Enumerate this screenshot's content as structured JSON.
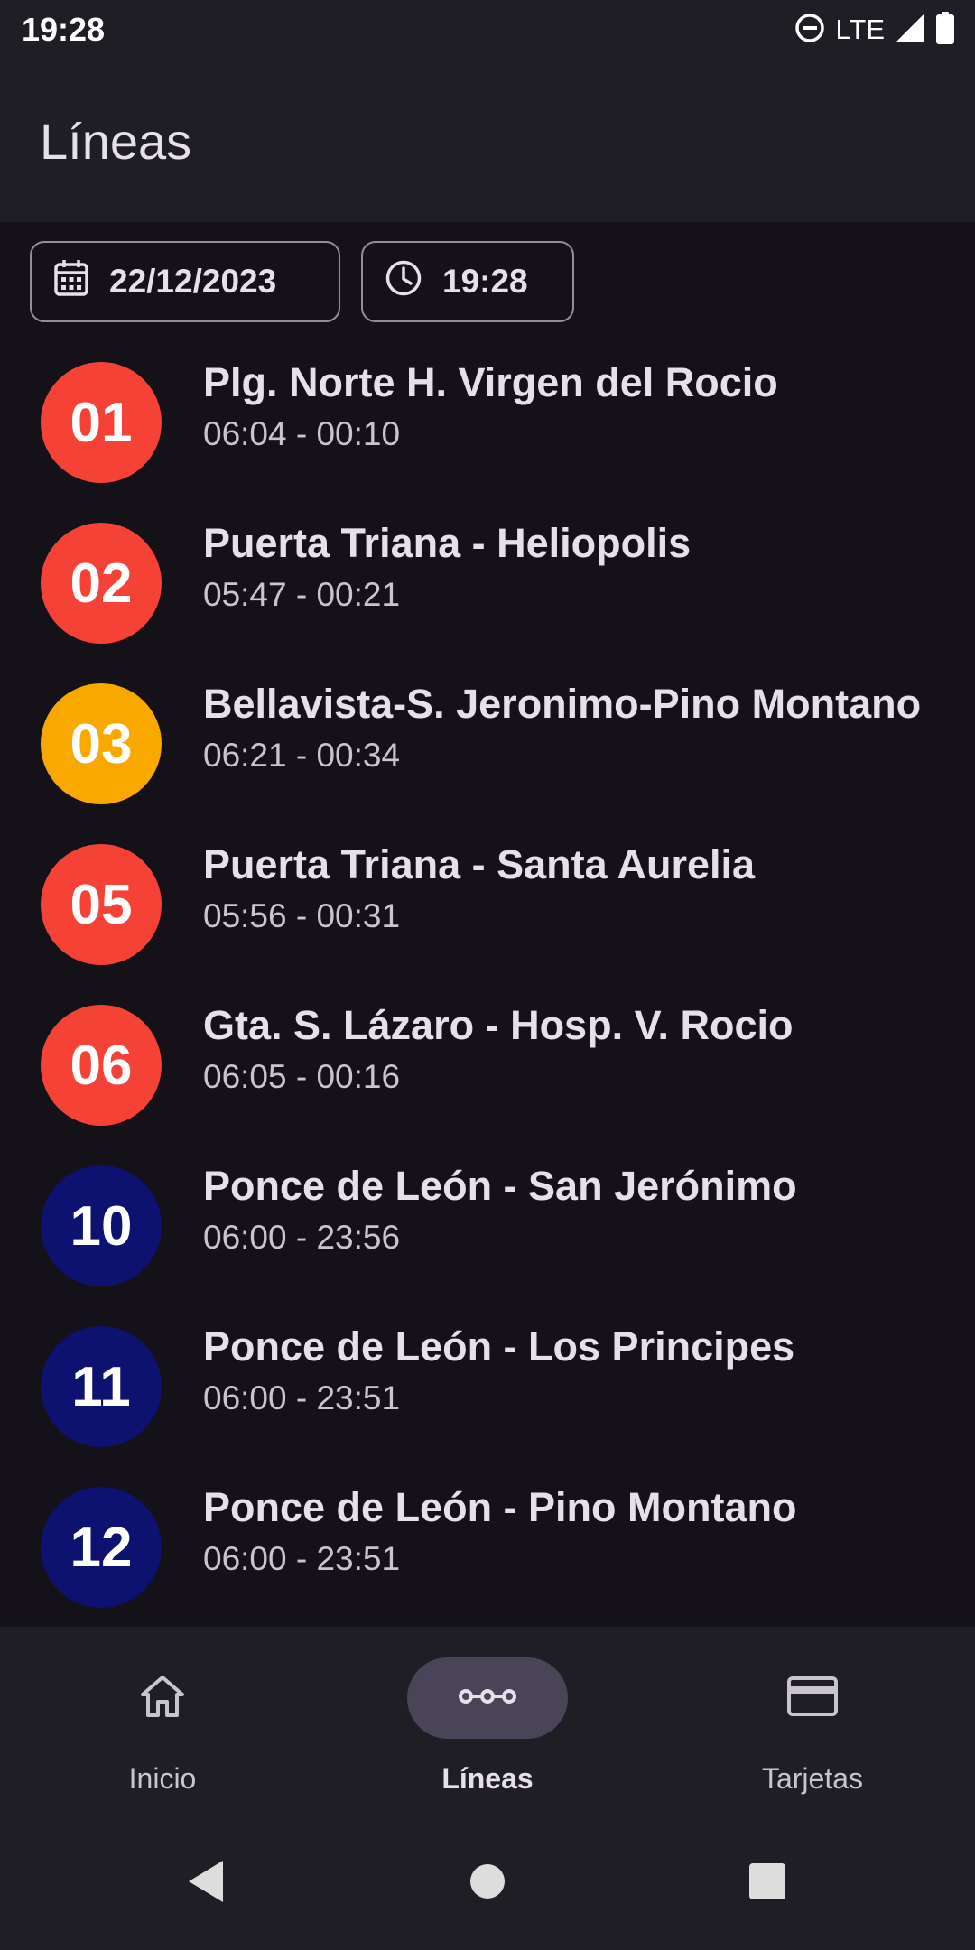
{
  "status_bar": {
    "time": "19:28",
    "network": "LTE",
    "icons": [
      "do-not-disturb-icon",
      "signal-icon",
      "battery-icon"
    ]
  },
  "app_bar": {
    "title": "Líneas"
  },
  "filters": {
    "date": {
      "value": "22/12/2023",
      "icon": "calendar-icon"
    },
    "time": {
      "value": "19:28",
      "icon": "clock-icon"
    }
  },
  "lines": [
    {
      "number": "01",
      "name": "Plg. Norte H. Virgen del Rocio",
      "hours": "06:04 - 00:10",
      "color": "#F44336"
    },
    {
      "number": "02",
      "name": "Puerta Triana - Heliopolis",
      "hours": "05:47 - 00:21",
      "color": "#F44336"
    },
    {
      "number": "03",
      "name": "Bellavista-S. Jeronimo-Pino Montano",
      "hours": "06:21 - 00:34",
      "color": "#F9A800"
    },
    {
      "number": "05",
      "name": "Puerta Triana - Santa Aurelia",
      "hours": "05:56 - 00:31",
      "color": "#F44336"
    },
    {
      "number": "06",
      "name": "Gta. S. Lázaro - Hosp. V. Rocio",
      "hours": "06:05 - 00:16",
      "color": "#F44336"
    },
    {
      "number": "10",
      "name": "Ponce de León - San Jerónimo",
      "hours": "06:00 - 23:56",
      "color": "#0D1170"
    },
    {
      "number": "11",
      "name": "Ponce de León - Los Principes",
      "hours": "06:00 - 23:51",
      "color": "#0D1170"
    },
    {
      "number": "12",
      "name": "Ponce de León -  Pino Montano",
      "hours": "06:00 - 23:51",
      "color": "#0D1170"
    }
  ],
  "bottom_nav": {
    "items": [
      {
        "label": "Inicio",
        "icon": "home-icon",
        "active": false
      },
      {
        "label": "Líneas",
        "icon": "route-icon",
        "active": true
      },
      {
        "label": "Tarjetas",
        "icon": "card-icon",
        "active": false
      }
    ]
  },
  "system_nav": {
    "buttons": [
      "back-icon",
      "home-circle-icon",
      "recents-icon"
    ]
  },
  "colors": {
    "background": "#141218",
    "surface": "#1F1E24",
    "active_pill": "#4A4458",
    "red_line": "#F44336",
    "yellow_line": "#F9A800",
    "blue_line": "#0D1170"
  }
}
